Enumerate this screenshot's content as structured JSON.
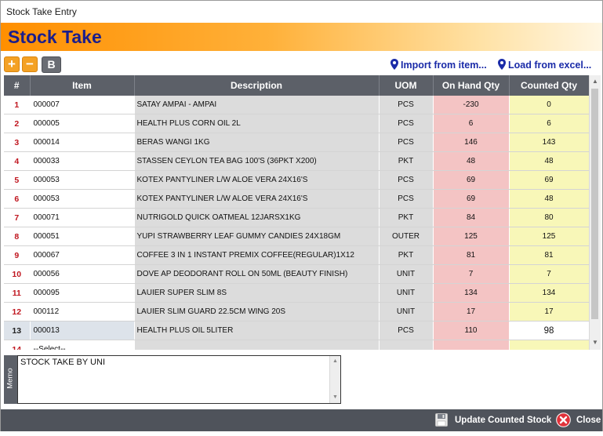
{
  "window": {
    "title": "Stock Take Entry"
  },
  "banner": {
    "title": "Stock Take"
  },
  "toolbar": {
    "add_label": "+",
    "remove_label": "−",
    "bold_label": "B",
    "import_link": "Import from item...",
    "load_link": "Load from excel..."
  },
  "table": {
    "columns": [
      "#",
      "Item",
      "Description",
      "UOM",
      "On Hand Qty",
      "Counted Qty"
    ],
    "rows": [
      {
        "n": "1",
        "item": "000007",
        "desc": "SATAY AMPAI - AMPAI",
        "uom": "PCS",
        "onhand": "-230",
        "counted": "0"
      },
      {
        "n": "2",
        "item": "000005",
        "desc": "HEALTH PLUS CORN OIL 2L",
        "uom": "PCS",
        "onhand": "6",
        "counted": "6"
      },
      {
        "n": "3",
        "item": "000014",
        "desc": "BERAS WANGI 1KG",
        "uom": "PCS",
        "onhand": "146",
        "counted": "143"
      },
      {
        "n": "4",
        "item": "000033",
        "desc": "STASSEN CEYLON TEA BAG 100'S (36PKT X200)",
        "uom": "PKT",
        "onhand": "48",
        "counted": "48"
      },
      {
        "n": "5",
        "item": "000053",
        "desc": "KOTEX PANTYLINER L/W ALOE VERA 24X16'S",
        "uom": "PCS",
        "onhand": "69",
        "counted": "69"
      },
      {
        "n": "6",
        "item": "000053",
        "desc": "KOTEX PANTYLINER L/W ALOE VERA 24X16'S",
        "uom": "PCS",
        "onhand": "69",
        "counted": "48"
      },
      {
        "n": "7",
        "item": "000071",
        "desc": "NUTRIGOLD QUICK OATMEAL 12JARSX1KG",
        "uom": "PKT",
        "onhand": "84",
        "counted": "80"
      },
      {
        "n": "8",
        "item": "000051",
        "desc": "YUPI STRAWBERRY LEAF GUMMY CANDIES 24X18GM",
        "uom": "OUTER",
        "onhand": "125",
        "counted": "125"
      },
      {
        "n": "9",
        "item": "000067",
        "desc": "COFFEE 3 IN 1 INSTANT PREMIX COFFEE(REGULAR)1X12",
        "uom": "PKT",
        "onhand": "81",
        "counted": "81"
      },
      {
        "n": "10",
        "item": "000056",
        "desc": "DOVE AP DEODORANT ROLL ON 50ML (BEAUTY FINISH)",
        "uom": "UNIT",
        "onhand": "7",
        "counted": "7"
      },
      {
        "n": "11",
        "item": "000095",
        "desc": "LAUIER SUPER SLIM 8S",
        "uom": "UNIT",
        "onhand": "134",
        "counted": "134"
      },
      {
        "n": "12",
        "item": "000112",
        "desc": "LAUIER SLIM GUARD 22.5CM WING 20S",
        "uom": "UNIT",
        "onhand": "17",
        "counted": "17"
      },
      {
        "n": "13",
        "item": "000013",
        "desc": "HEALTH PLUS OIL 5LITER",
        "uom": "PCS",
        "onhand": "110",
        "counted": "98"
      },
      {
        "n": "14",
        "item": "--Select--",
        "desc": "",
        "uom": "",
        "onhand": "",
        "counted": ""
      }
    ]
  },
  "memo": {
    "label": "Memo",
    "text": "STOCK TAKE BY UNI"
  },
  "footer": {
    "update_label": "Update Counted Stock",
    "close_label": "Close"
  },
  "colors": {
    "accent": "#ff8f00",
    "title_blue": "#1a1e8c",
    "header_gray": "#5c6068",
    "onhand_pink": "#f4c4c4",
    "counted_yellow": "#f8f7b8"
  }
}
